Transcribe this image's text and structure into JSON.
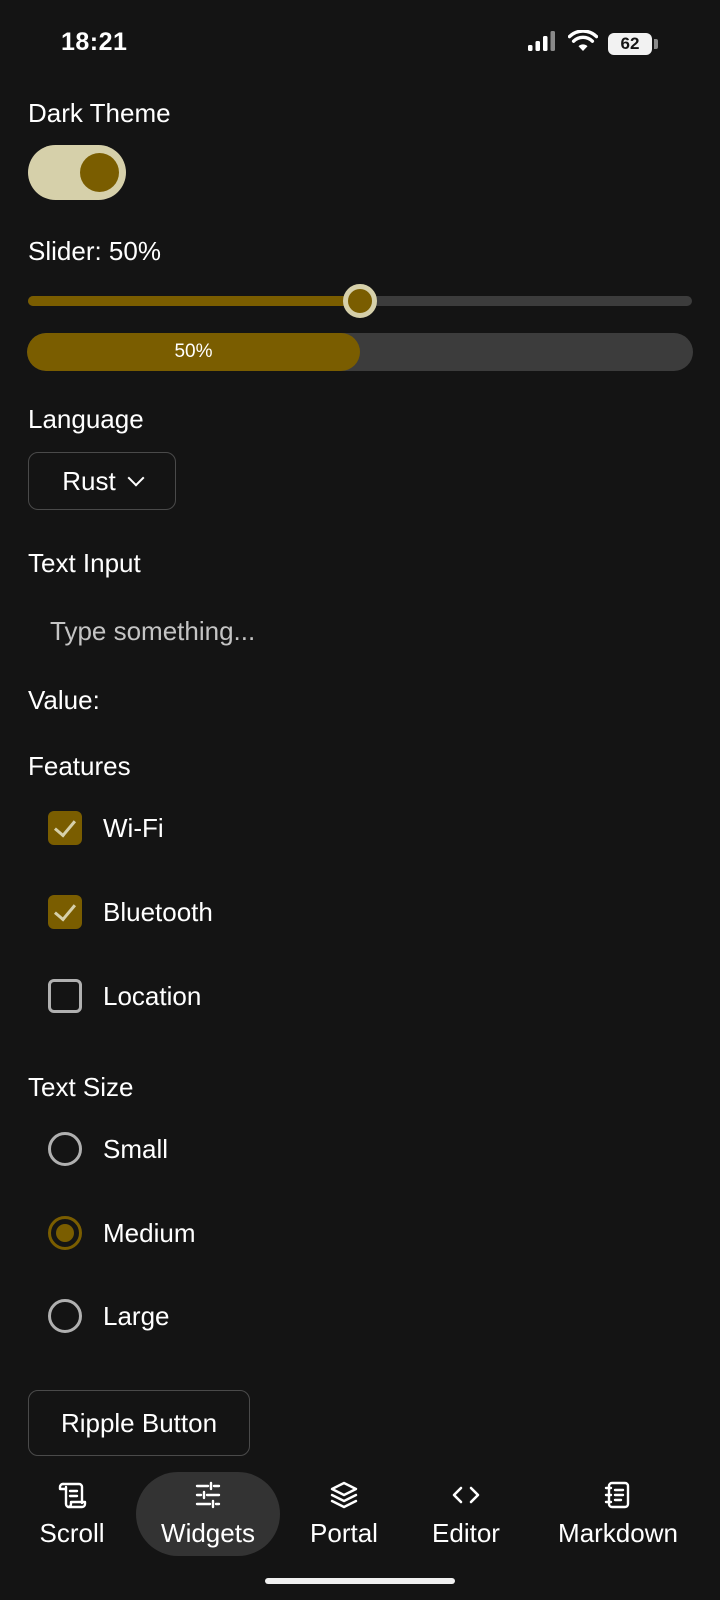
{
  "status_bar": {
    "time": "18:21",
    "battery": "62"
  },
  "theme": {
    "label": "Dark Theme",
    "enabled": true
  },
  "slider": {
    "label": "Slider: 50%",
    "value": 0.5
  },
  "progress": {
    "text": "50%",
    "value": 0.5
  },
  "language": {
    "label": "Language",
    "selected": "Rust"
  },
  "text_input": {
    "label": "Text Input",
    "placeholder": "Type something...",
    "value": ""
  },
  "value_label": "Value:",
  "features": {
    "label": "Features",
    "items": [
      {
        "label": "Wi-Fi",
        "checked": true
      },
      {
        "label": "Bluetooth",
        "checked": true
      },
      {
        "label": "Location",
        "checked": false
      }
    ]
  },
  "text_size": {
    "label": "Text Size",
    "options": [
      {
        "label": "Small",
        "selected": false
      },
      {
        "label": "Medium",
        "selected": true
      },
      {
        "label": "Large",
        "selected": false
      }
    ]
  },
  "ripple_button": {
    "label": "Ripple Button"
  },
  "nav": {
    "items": [
      {
        "label": "Scroll",
        "icon": "scroll-icon",
        "active": false
      },
      {
        "label": "Widgets",
        "icon": "sliders-icon",
        "active": true
      },
      {
        "label": "Portal",
        "icon": "layers-icon",
        "active": false
      },
      {
        "label": "Editor",
        "icon": "code-icon",
        "active": false
      },
      {
        "label": "Markdown",
        "icon": "notebook-icon",
        "active": false
      }
    ]
  },
  "colors": {
    "background": "#141414",
    "accent": "#7a5d00",
    "accent_light": "#d6d0aa",
    "track": "#3c3c3c"
  }
}
